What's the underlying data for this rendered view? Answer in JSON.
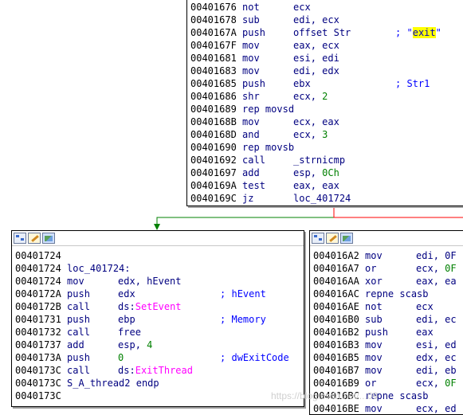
{
  "colors": {
    "edge_true": "#008000",
    "edge_false": "#ff0000",
    "address": "#000000",
    "mnemonic": "#000080",
    "number": "#008000",
    "function": "#ff00ff",
    "comment": "#0000ff",
    "highlight": "#ffff00"
  },
  "icons": [
    "graph-icon",
    "pencil-icon",
    "picture-icon"
  ],
  "top_block": {
    "lines": [
      {
        "addr": "00401676",
        "mn": "not",
        "op": [
          {
            "t": "ecx"
          }
        ]
      },
      {
        "addr": "00401678",
        "mn": "sub",
        "op": [
          {
            "t": "edi, ecx"
          }
        ]
      },
      {
        "addr": "0040167A",
        "mn": "push",
        "op": [
          {
            "t": "offset Str"
          }
        ],
        "comment": [
          {
            "t": "; \""
          },
          {
            "t": "exit",
            "c": "str"
          },
          {
            "t": "\""
          }
        ]
      },
      {
        "addr": "0040167F",
        "mn": "mov",
        "op": [
          {
            "t": "eax, ecx"
          }
        ]
      },
      {
        "addr": "00401681",
        "mn": "mov",
        "op": [
          {
            "t": "esi, edi"
          }
        ]
      },
      {
        "addr": "00401683",
        "mn": "mov",
        "op": [
          {
            "t": "edi, edx"
          }
        ]
      },
      {
        "addr": "00401685",
        "mn": "push",
        "op": [
          {
            "t": "ebx"
          }
        ],
        "comment": [
          {
            "t": "; Str1"
          }
        ]
      },
      {
        "addr": "00401686",
        "mn": "shr",
        "op": [
          {
            "t": "ecx, "
          },
          {
            "t": "2",
            "c": "num"
          }
        ]
      },
      {
        "addr": "00401689",
        "mn": "rep movsd",
        "op": []
      },
      {
        "addr": "0040168B",
        "mn": "mov",
        "op": [
          {
            "t": "ecx, eax"
          }
        ]
      },
      {
        "addr": "0040168D",
        "mn": "and",
        "op": [
          {
            "t": "ecx, "
          },
          {
            "t": "3",
            "c": "num"
          }
        ]
      },
      {
        "addr": "00401690",
        "mn": "rep movsb",
        "op": []
      },
      {
        "addr": "00401692",
        "mn": "call",
        "op": [
          {
            "t": "_strnicmp"
          }
        ]
      },
      {
        "addr": "00401697",
        "mn": "add",
        "op": [
          {
            "t": "esp, "
          },
          {
            "t": "0Ch",
            "c": "num"
          }
        ]
      },
      {
        "addr": "0040169A",
        "mn": "test",
        "op": [
          {
            "t": "eax, eax"
          }
        ]
      },
      {
        "addr": "0040169C",
        "mn": "jz",
        "op": [
          {
            "t": "loc_401724"
          }
        ]
      }
    ]
  },
  "left_block": {
    "lines": [
      {
        "addr": "00401724",
        "mn": "",
        "op": []
      },
      {
        "addr": "00401724",
        "label": "loc_401724:",
        "mn": "",
        "op": []
      },
      {
        "addr": "00401724",
        "mn": "mov",
        "op": [
          {
            "t": "edx, hEvent"
          }
        ]
      },
      {
        "addr": "0040172A",
        "mn": "push",
        "op": [
          {
            "t": "edx"
          }
        ],
        "comment": [
          {
            "t": "; hEvent"
          }
        ]
      },
      {
        "addr": "0040172B",
        "mn": "call",
        "op": [
          {
            "t": "ds:"
          },
          {
            "t": "SetEvent",
            "c": "fn"
          }
        ]
      },
      {
        "addr": "00401731",
        "mn": "push",
        "op": [
          {
            "t": "ebp"
          }
        ],
        "comment": [
          {
            "t": "; Memory"
          }
        ]
      },
      {
        "addr": "00401732",
        "mn": "call",
        "op": [
          {
            "t": "free"
          }
        ]
      },
      {
        "addr": "00401737",
        "mn": "add",
        "op": [
          {
            "t": "esp, "
          },
          {
            "t": "4",
            "c": "num"
          }
        ]
      },
      {
        "addr": "0040173A",
        "mn": "push",
        "op": [
          {
            "t": "0",
            "c": "num"
          }
        ],
        "comment": [
          {
            "t": "; dwExitCode"
          }
        ]
      },
      {
        "addr": "0040173C",
        "mn": "call",
        "op": [
          {
            "t": "ds:"
          },
          {
            "t": "ExitThread",
            "c": "fn"
          }
        ]
      },
      {
        "addr": "0040173C",
        "label": "S_A_thread2 endp",
        "mn": "",
        "op": []
      },
      {
        "addr": "0040173C",
        "mn": "",
        "op": []
      }
    ]
  },
  "right_block": {
    "lines": [
      {
        "addr": "004016A2",
        "mn": "mov",
        "op": [
          {
            "t": "edi, 0F"
          }
        ]
      },
      {
        "addr": "004016A7",
        "mn": "or",
        "op": [
          {
            "t": "ecx, "
          },
          {
            "t": "0F",
            "c": "num"
          }
        ]
      },
      {
        "addr": "004016AA",
        "mn": "xor",
        "op": [
          {
            "t": "eax, ea"
          }
        ]
      },
      {
        "addr": "004016AC",
        "mn": "repne scasb",
        "op": []
      },
      {
        "addr": "004016AE",
        "mn": "not",
        "op": [
          {
            "t": "ecx"
          }
        ]
      },
      {
        "addr": "004016B0",
        "mn": "sub",
        "op": [
          {
            "t": "edi, ec"
          }
        ]
      },
      {
        "addr": "004016B2",
        "mn": "push",
        "op": [
          {
            "t": "eax"
          }
        ]
      },
      {
        "addr": "004016B3",
        "mn": "mov",
        "op": [
          {
            "t": "esi, ed"
          }
        ]
      },
      {
        "addr": "004016B5",
        "mn": "mov",
        "op": [
          {
            "t": "edx, ec"
          }
        ]
      },
      {
        "addr": "004016B7",
        "mn": "mov",
        "op": [
          {
            "t": "edi, eb"
          }
        ]
      },
      {
        "addr": "004016B9",
        "mn": "or",
        "op": [
          {
            "t": "ecx, "
          },
          {
            "t": "0F",
            "c": "num"
          }
        ]
      },
      {
        "addr": "004016BC",
        "mn": "repne scasb",
        "op": []
      },
      {
        "addr": "004016BE",
        "mn": "mov",
        "op": [
          {
            "t": "ecx, ed"
          }
        ]
      }
    ]
  },
  "watermark": "https://blog.csdn.net/...09"
}
